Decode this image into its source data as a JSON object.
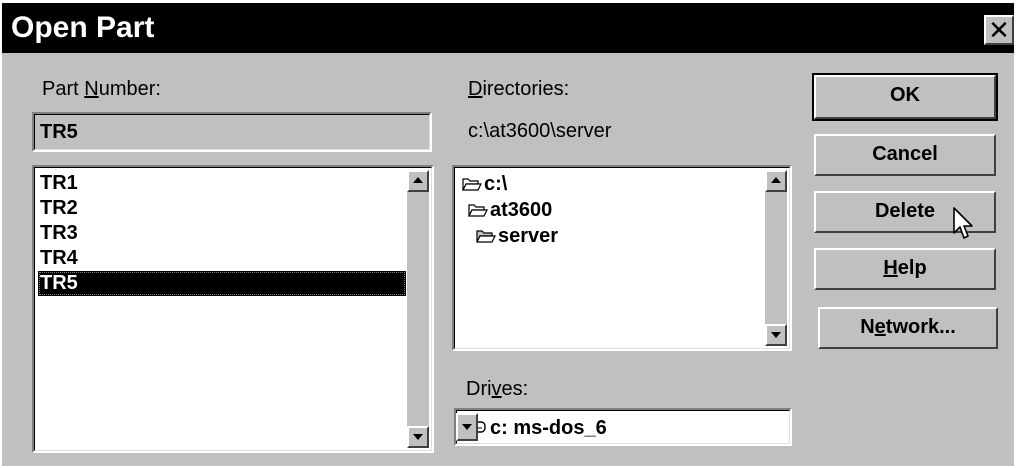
{
  "window": {
    "title": "Open Part",
    "close_glyph": "✕"
  },
  "part_number": {
    "label_pre": "Part ",
    "label_accel": "N",
    "label_post": "umber:",
    "value": "TR5",
    "items": [
      {
        "label": "TR1"
      },
      {
        "label": "TR2"
      },
      {
        "label": "TR3"
      },
      {
        "label": "TR4"
      },
      {
        "label": "TR5",
        "selected": true
      }
    ]
  },
  "directories": {
    "label_accel": "D",
    "label_post": "irectories:",
    "current_path": "c:\\at3600\\server",
    "tree": [
      {
        "label": "c:\\",
        "icon": "open-folder-icon"
      },
      {
        "label": "at3600",
        "icon": "open-folder-icon"
      },
      {
        "label": "server",
        "icon": "open-folder-icon"
      }
    ]
  },
  "drives": {
    "label_pre": "Dri",
    "label_accel": "v",
    "label_post": "es:",
    "selected": "c: ms-dos_6",
    "icon": "hard-drive-icon"
  },
  "buttons": {
    "ok": "OK",
    "cancel": "Cancel",
    "delete": "Delete",
    "help_accel": "H",
    "help_post": "elp",
    "network_pre": "N",
    "network_accel": "e",
    "network_post": "twork..."
  },
  "colors": {
    "face": "#c0c0c0",
    "title_bar": "#000000",
    "selection": "#000000"
  }
}
